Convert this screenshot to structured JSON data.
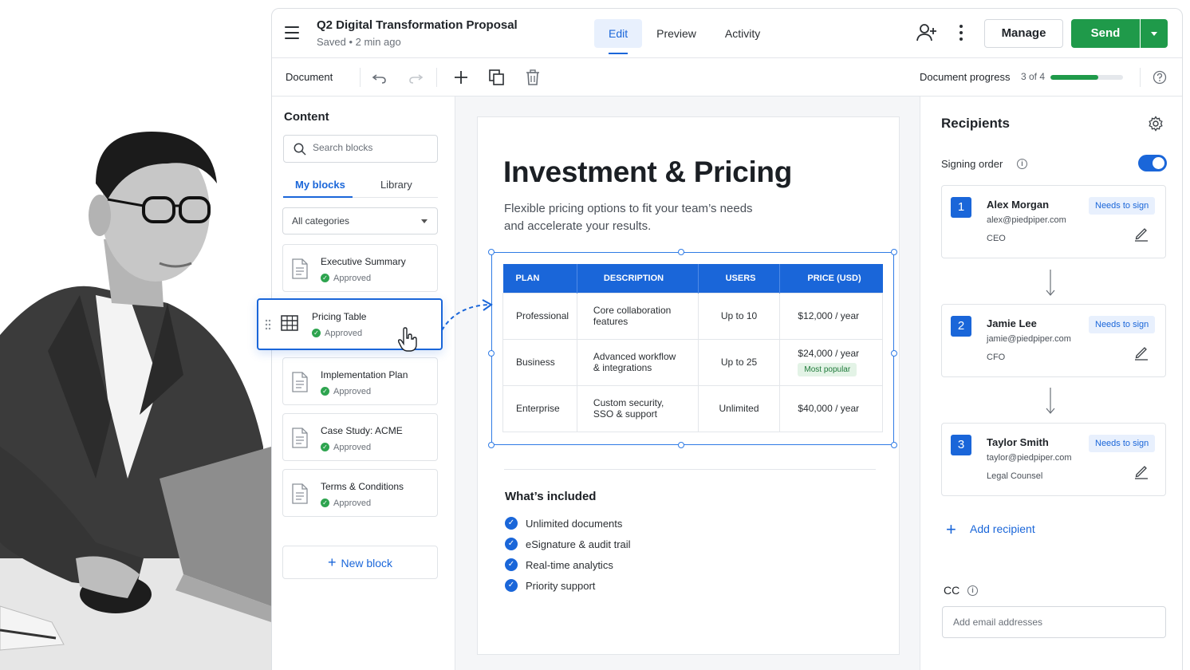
{
  "header": {
    "title": "Q2 Digital Transformation Proposal",
    "status": "Saved • 2 min ago",
    "tabs": [
      {
        "label": "Edit",
        "active": true
      },
      {
        "label": "Preview",
        "active": false
      },
      {
        "label": "Activity",
        "active": false
      }
    ],
    "manage_label": "Manage",
    "send_label": "Send"
  },
  "toolbar": {
    "label": "Document",
    "progress_label": "Document progress",
    "progress_count": "3 of 4",
    "progress_fraction": 0.66
  },
  "content_panel": {
    "title": "Content",
    "search_placeholder": "Search blocks",
    "tabs": [
      "My blocks",
      "Library"
    ],
    "category_select": "All categories",
    "blocks": [
      {
        "name": "Executive Summary",
        "status": "Approved"
      },
      {
        "name": "Implementation Plan",
        "status": "Approved"
      },
      {
        "name": "Case Study: ACME",
        "status": "Approved"
      },
      {
        "name": "Terms & Conditions",
        "status": "Approved"
      }
    ],
    "dragging_block": {
      "name": "Pricing Table",
      "status": "Approved"
    },
    "new_block_label": "New block"
  },
  "document": {
    "heading": "Investment & Pricing",
    "subheading": "Flexible pricing options to fit your team’s needs and accelerate your results.",
    "table": {
      "headers": [
        "PLAN",
        "DESCRIPTION",
        "USERS",
        "PRICE (USD)"
      ],
      "rows": [
        {
          "plan": "Professional",
          "description": "Core collaboration features",
          "users": "Up to 10",
          "price": "$12,000 / year",
          "badge": ""
        },
        {
          "plan": "Business",
          "description": "Advanced workflow & integrations",
          "users": "Up to 25",
          "price": "$24,000 / year",
          "badge": "Most popular"
        },
        {
          "plan": "Enterprise",
          "description": "Custom security, SSO & support",
          "users": "Unlimited",
          "price": "$40,000 / year",
          "badge": ""
        }
      ]
    },
    "included_title": "What’s included",
    "included": [
      "Unlimited documents",
      "eSignature & audit trail",
      "Real-time analytics",
      "Priority support"
    ]
  },
  "recipients": {
    "title": "Recipients",
    "signing_order_label": "Signing order",
    "signing_order_enabled": true,
    "list": [
      {
        "number": "1",
        "name": "Alex Morgan",
        "email": "alex@piedpiper.com",
        "role": "CEO",
        "status": "Needs to sign"
      },
      {
        "number": "2",
        "name": "Jamie Lee",
        "email": "jamie@piedpiper.com",
        "role": "CFO",
        "status": "Needs to sign"
      },
      {
        "number": "3",
        "name": "Taylor Smith",
        "email": "taylor@piedpiper.com",
        "role": "Legal Counsel",
        "status": "Needs to sign"
      }
    ],
    "add_label": "Add recipient",
    "cc_label": "CC",
    "cc_placeholder": "Add email addresses"
  },
  "colors": {
    "accent": "#1a66d9",
    "send": "#1f9a4a",
    "approved": "#2ea44f",
    "badge_bg": "#e8f0fd",
    "popular_bg": "#e3f3e6"
  }
}
